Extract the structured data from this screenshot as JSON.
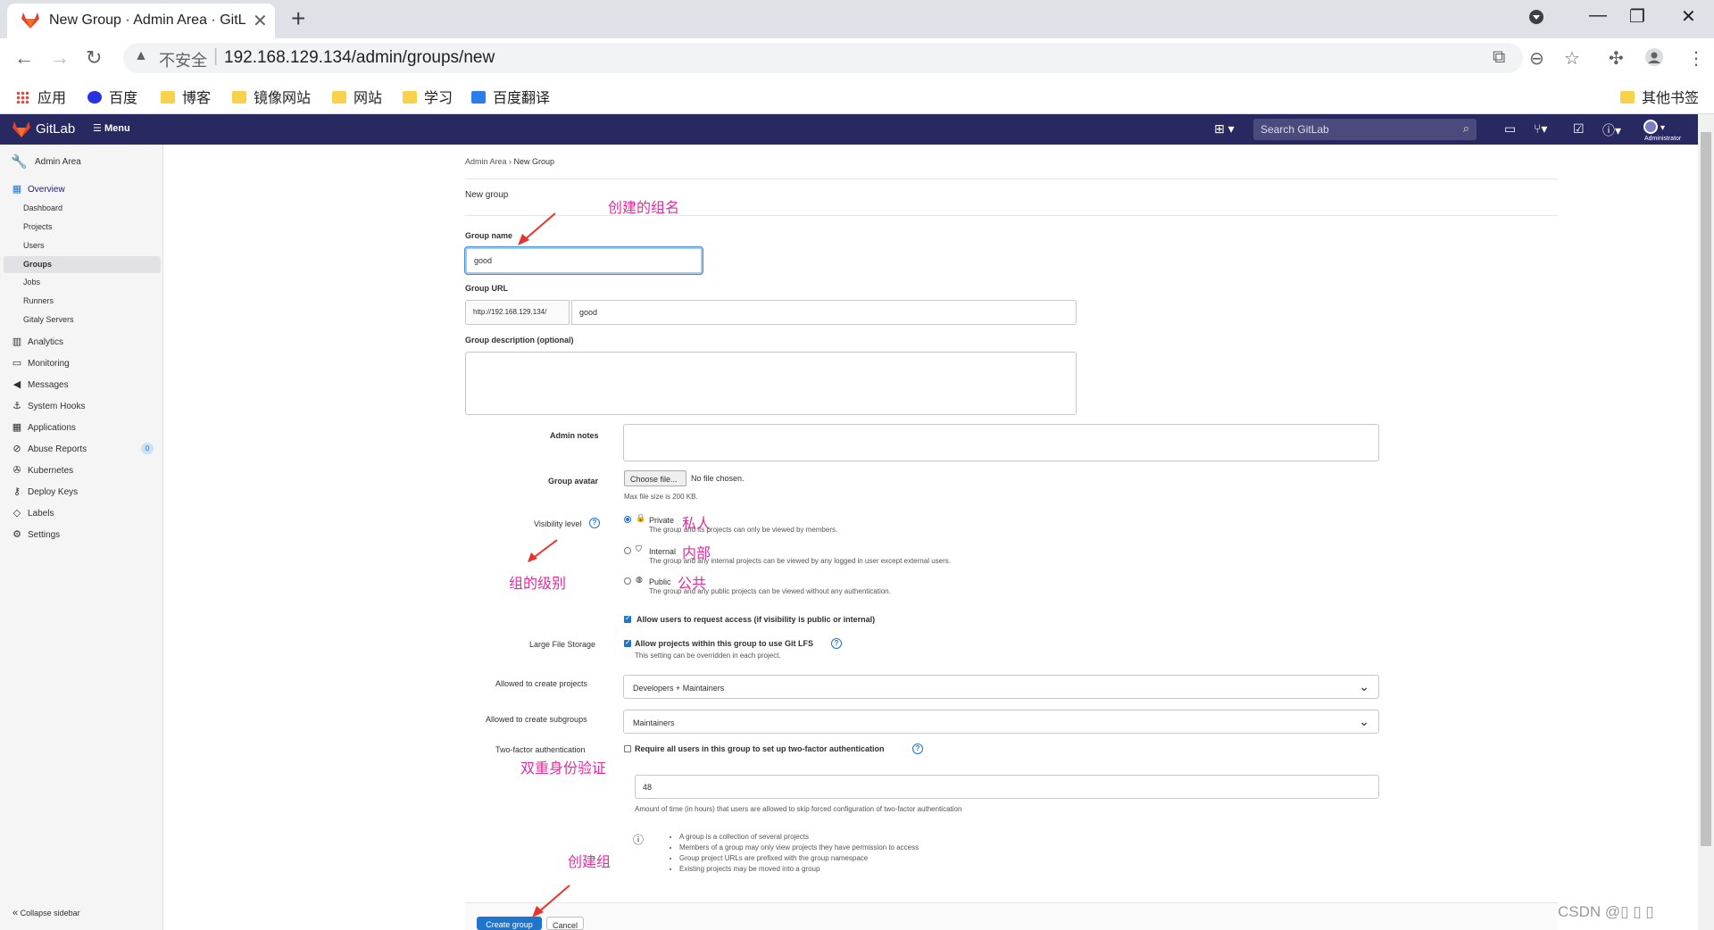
{
  "browser": {
    "tab_title": "New Group · Admin Area · GitL",
    "insecure_label": "不安全",
    "url": "192.168.129.134/admin/groups/new",
    "bookmarks": [
      {
        "label": "应用",
        "icon": "apps-grid-icon"
      },
      {
        "label": "百度",
        "icon": "baidu-paw-icon"
      },
      {
        "label": "博客",
        "icon": "folder-icon"
      },
      {
        "label": "镜像网站",
        "icon": "folder-icon"
      },
      {
        "label": "网站",
        "icon": "folder-icon"
      },
      {
        "label": "学习",
        "icon": "folder-icon"
      },
      {
        "label": "百度翻译",
        "icon": "baidu-translate-icon"
      }
    ],
    "other_bookmarks": "其他书签"
  },
  "gitlab_header": {
    "brand": "GitLab",
    "menu_label": "Menu",
    "search_placeholder": "Search GitLab",
    "avatar_label": "Administrator"
  },
  "sidebar": {
    "title": "Admin Area",
    "overview_label": "Overview",
    "overview_items": [
      "Dashboard",
      "Projects",
      "Users",
      "Groups",
      "Jobs",
      "Runners",
      "Gitaly Servers"
    ],
    "active_item": "Groups",
    "items": [
      {
        "label": "Analytics",
        "icon": "chart-icon"
      },
      {
        "label": "Monitoring",
        "icon": "monitor-icon"
      },
      {
        "label": "Messages",
        "icon": "megaphone-icon"
      },
      {
        "label": "System Hooks",
        "icon": "hook-icon"
      },
      {
        "label": "Applications",
        "icon": "apps-icon"
      },
      {
        "label": "Abuse Reports",
        "icon": "abuse-icon",
        "badge": "0"
      },
      {
        "label": "Kubernetes",
        "icon": "kubernetes-icon"
      },
      {
        "label": "Deploy Keys",
        "icon": "key-icon"
      },
      {
        "label": "Labels",
        "icon": "label-icon"
      },
      {
        "label": "Settings",
        "icon": "gear-icon"
      }
    ],
    "collapse_label": "Collapse sidebar"
  },
  "form": {
    "breadcrumb_root": "Admin Area",
    "breadcrumb_current": "New Group",
    "heading": "New group",
    "group_name_label": "Group name",
    "group_name_value": "good",
    "group_url_label": "Group URL",
    "group_url_prefix": "http://192.168.129.134/",
    "group_url_value": "good",
    "description_label": "Group description (optional)",
    "admin_notes_label": "Admin notes",
    "avatar_label": "Group avatar",
    "choose_file": "Choose file...",
    "no_file": "No file chosen.",
    "max_file": "Max file size is 200 KB.",
    "visibility_label": "Visibility level",
    "visibility_options": [
      {
        "name": "Private",
        "desc": "The group and its projects can only be viewed by members.",
        "selected": true
      },
      {
        "name": "Internal",
        "desc": "The group and any internal projects can be viewed by any logged in user except external users.",
        "selected": false
      },
      {
        "name": "Public",
        "desc": "The group and any public projects can be viewed without any authentication.",
        "selected": false
      }
    ],
    "request_access": "Allow users to request access (if visibility is public or internal)",
    "lfs_label": "Large File Storage",
    "lfs_check": "Allow projects within this group to use Git LFS",
    "lfs_help": "This setting can be overridden in each project.",
    "create_projects_label": "Allowed to create projects",
    "create_projects_value": "Developers + Maintainers",
    "create_subgroups_label": "Allowed to create subgroups",
    "create_subgroups_value": "Maintainers",
    "twofa_label": "Two-factor authentication",
    "twofa_check": "Require all users in this group to set up two-factor authentication",
    "grace_value": "48",
    "grace_help": "Amount of time (in hours) that users are allowed to skip forced configuration of two-factor authentication",
    "info_items": [
      "A group is a collection of several projects",
      "Members of a group may only view projects they have permission to access",
      "Group project URLs are prefixed with the group namespace",
      "Existing projects may be moved into a group"
    ],
    "create_button": "Create group",
    "cancel_button": "Cancel"
  },
  "annotations": {
    "group_name": "创建的组名",
    "private": "私人",
    "internal": "内部",
    "public": "公共",
    "visibility": "组的级别",
    "twofa": "双重身份验证",
    "create": "创建组",
    "color": "#e02ea0"
  },
  "watermark": "CSDN @▯ ▯ ▯"
}
